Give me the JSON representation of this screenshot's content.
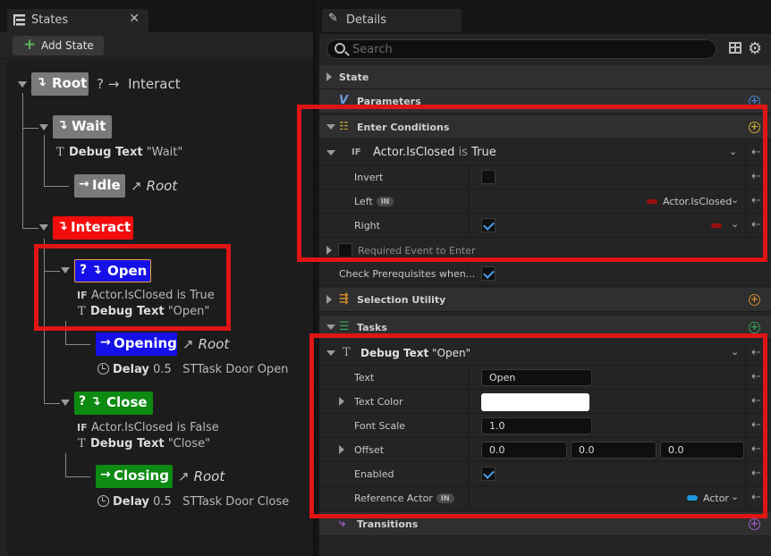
{
  "states_panel": {
    "tab_title": "States",
    "close_glyph": "✕",
    "add_state_label": "Add State"
  },
  "tree": {
    "root": {
      "label": "Root",
      "transition_prefix": "? →",
      "transition_target": "Interact",
      "color": "#7a7a7a"
    },
    "wait": {
      "label": "Wait",
      "task_name": "Debug Text",
      "task_value": "\"Wait\"",
      "color": "#7a7a7a"
    },
    "idle": {
      "label": "Idle",
      "transition_target": "Root",
      "color": "#7a7a7a"
    },
    "interact": {
      "label": "Interact",
      "color": "#f20d0d"
    },
    "open": {
      "label": "Open",
      "prefix": "?",
      "condition_subject": "Actor.IsClosed",
      "condition_op": "is",
      "condition_value": "True",
      "task_name": "Debug Text",
      "task_value": "\"Open\"",
      "color": "#1510e8"
    },
    "opening": {
      "label": "Opening",
      "transition_target": "Root",
      "delay_label": "Delay",
      "delay_value": "0.5",
      "task": "STTask Door Open",
      "color": "#1510e8"
    },
    "close": {
      "label": "Close",
      "prefix": "?",
      "condition_subject": "Actor.IsClosed",
      "condition_op": "is",
      "condition_value": "False",
      "task_name": "Debug Text",
      "task_value": "\"Close\"",
      "color": "#0d8a12"
    },
    "closing": {
      "label": "Closing",
      "transition_target": "Root",
      "delay_label": "Delay",
      "delay_value": "0.5",
      "task": "STTask Door Close",
      "color": "#0d8a12"
    },
    "if_label": "IF"
  },
  "details_panel": {
    "tab_title": "Details",
    "search_placeholder": "Search",
    "state_label": "State",
    "parameters_label": "Parameters",
    "enter_conditions_label": "Enter Conditions",
    "condition_if": "IF",
    "condition_subject": "Actor.IsClosed",
    "condition_op": "is",
    "condition_value": "True",
    "invert_label": "Invert",
    "invert_checked": false,
    "left_label": "Left",
    "in_badge": "IN",
    "left_value": "Actor.IsClosed",
    "right_label": "Right",
    "right_checked": true,
    "required_event_label": "Required Event to Enter",
    "check_prereq_label": "Check Prerequisites when...",
    "check_prereq_checked": true,
    "selection_utility_label": "Selection Utility",
    "tasks_label": "Tasks",
    "task_name": "Debug Text",
    "task_value": "\"Open\"",
    "text_label": "Text",
    "text_value": "Open",
    "text_color_label": "Text Color",
    "text_color_value": "#ffffff",
    "font_scale_label": "Font Scale",
    "font_scale_value": "1.0",
    "offset_label": "Offset",
    "offset_x": "0.0",
    "offset_y": "0.0",
    "offset_z": "0.0",
    "enabled_label": "Enabled",
    "enabled_checked": true,
    "reference_actor_label": "Reference Actor",
    "reference_actor_value": "Actor",
    "transitions_label": "Transitions"
  },
  "colors": {
    "highlight": "#e01515",
    "panel_bg": "#242424",
    "accent_blue": "#4a9eea"
  }
}
